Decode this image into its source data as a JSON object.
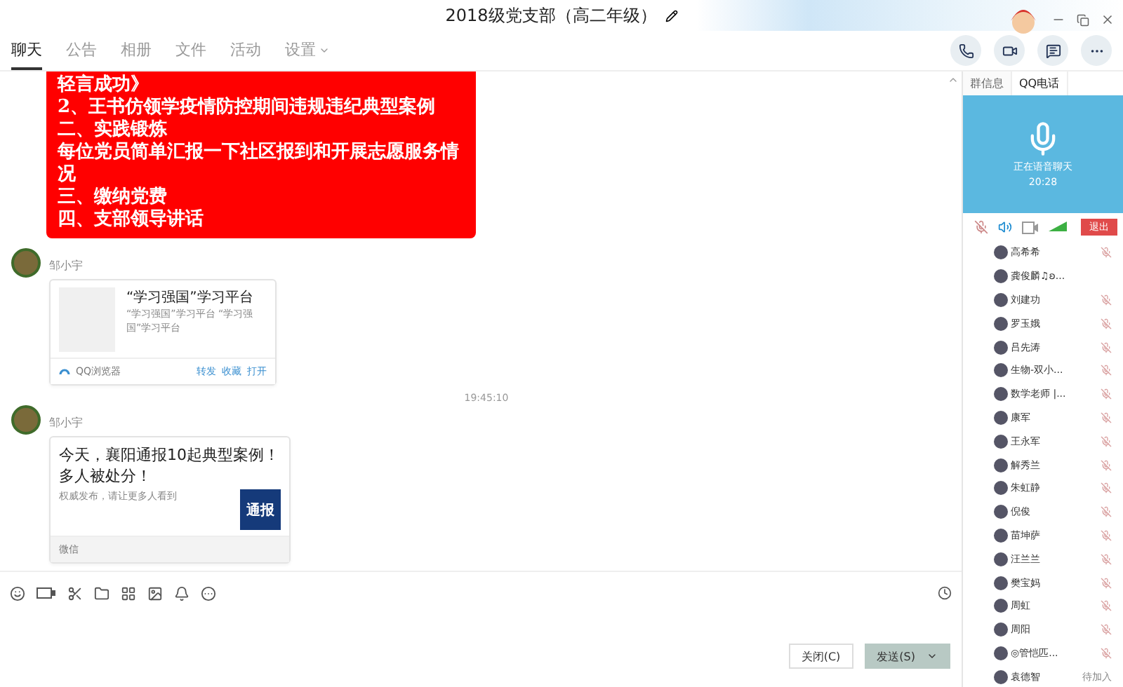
{
  "window": {
    "title": "2018级党支部（高二年级）"
  },
  "tabs": [
    {
      "label": "聊天",
      "selected": true
    },
    {
      "label": "公告",
      "selected": false
    },
    {
      "label": "相册",
      "selected": false
    },
    {
      "label": "文件",
      "selected": false
    },
    {
      "label": "活动",
      "selected": false
    },
    {
      "label": "设置",
      "selected": false,
      "dropdown": true
    }
  ],
  "messages": [
    {
      "kind": "notice",
      "lines": [
        "轻言成功》",
        "2、王书仿领学疫情防控期间违规违纪典型案例",
        "二、实践锻炼",
        "每位党员简单汇报一下社区报到和开展志愿服务情况",
        "三、缴纳党费",
        "四、支部领导讲话"
      ]
    },
    {
      "kind": "link",
      "sender": "邹小宇",
      "title": "“学习强国”学习平台",
      "description": "“学习强国”学习平台 “学习强国”学习平台",
      "source": "QQ浏览器",
      "actions": [
        "转发",
        "收藏",
        "打开"
      ]
    },
    {
      "kind": "time",
      "text": "19:45:10"
    },
    {
      "kind": "article",
      "sender": "邹小宇",
      "title": "今天，襄阳通报10起典型案例！多人被处分！",
      "description": "权威发布，请让更多人看到",
      "thumb_text": "通报",
      "source": "微信"
    }
  ],
  "buttons": {
    "close": "关闭(C)",
    "send": "发送(S)"
  },
  "side_tabs": [
    {
      "label": "群信息",
      "selected": false
    },
    {
      "label": "QQ电话",
      "selected": true
    }
  ],
  "call": {
    "status": "正在语音聊天",
    "duration": "20:28",
    "mic_muted": true,
    "exit": "退出"
  },
  "members": [
    {
      "name": "高希希",
      "muted": true
    },
    {
      "name": "龚俊麟♫ʚ...",
      "muted": false
    },
    {
      "name": "刘建功",
      "muted": true
    },
    {
      "name": "罗玉娥",
      "muted": true
    },
    {
      "name": "吕先涛",
      "muted": true
    },
    {
      "name": "生物-双小...",
      "muted": true
    },
    {
      "name": "数学老师 |...",
      "muted": true
    },
    {
      "name": "康军",
      "muted": true
    },
    {
      "name": "王永军",
      "muted": true
    },
    {
      "name": "解秀兰",
      "muted": true
    },
    {
      "name": "朱虹静",
      "muted": true
    },
    {
      "name": "倪俊",
      "muted": true
    },
    {
      "name": "苗坤萨",
      "muted": true
    },
    {
      "name": "汪兰兰",
      "muted": true
    },
    {
      "name": "樊宝妈",
      "muted": true
    },
    {
      "name": "周虹",
      "muted": true
    },
    {
      "name": "周阳",
      "muted": true
    },
    {
      "name": "◎管恺匹...",
      "muted": true
    },
    {
      "name": "袁德智",
      "muted": false,
      "status": "待加入"
    }
  ]
}
